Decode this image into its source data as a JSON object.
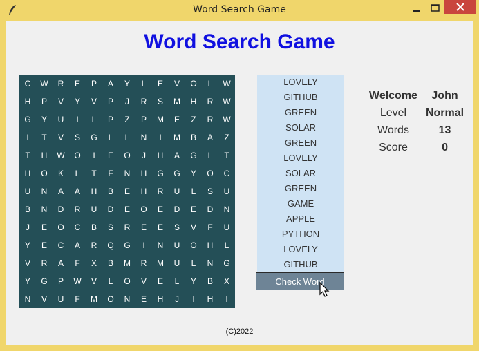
{
  "window": {
    "title": "Word Search Game"
  },
  "heading": "Word Search Game",
  "grid": [
    [
      "C",
      "W",
      "R",
      "E",
      "P",
      "A",
      "Y",
      "L",
      "E",
      "V",
      "O",
      "L",
      "W"
    ],
    [
      "H",
      "P",
      "V",
      "Y",
      "V",
      "P",
      "J",
      "R",
      "S",
      "M",
      "H",
      "R",
      "W"
    ],
    [
      "G",
      "Y",
      "U",
      "I",
      "L",
      "P",
      "Z",
      "P",
      "M",
      "E",
      "Z",
      "R",
      "W"
    ],
    [
      "I",
      "T",
      "V",
      "S",
      "G",
      "L",
      "L",
      "N",
      "I",
      "M",
      "B",
      "A",
      "Z"
    ],
    [
      "T",
      "H",
      "W",
      "O",
      "I",
      "E",
      "O",
      "J",
      "H",
      "A",
      "G",
      "L",
      "T"
    ],
    [
      "H",
      "O",
      "K",
      "L",
      "T",
      "F",
      "N",
      "H",
      "G",
      "G",
      "Y",
      "O",
      "C"
    ],
    [
      "U",
      "N",
      "A",
      "A",
      "H",
      "B",
      "E",
      "H",
      "R",
      "U",
      "L",
      "S",
      "U"
    ],
    [
      "B",
      "N",
      "D",
      "R",
      "U",
      "D",
      "E",
      "O",
      "E",
      "D",
      "E",
      "D",
      "N"
    ],
    [
      "J",
      "E",
      "O",
      "C",
      "B",
      "S",
      "R",
      "E",
      "E",
      "S",
      "V",
      "F",
      "U"
    ],
    [
      "Y",
      "E",
      "C",
      "A",
      "R",
      "Q",
      "G",
      "I",
      "N",
      "U",
      "O",
      "H",
      "L"
    ],
    [
      "V",
      "R",
      "A",
      "F",
      "X",
      "B",
      "M",
      "R",
      "M",
      "U",
      "L",
      "N",
      "G"
    ],
    [
      "Y",
      "G",
      "P",
      "W",
      "V",
      "L",
      "O",
      "V",
      "E",
      "L",
      "Y",
      "B",
      "X"
    ],
    [
      "N",
      "V",
      "U",
      "F",
      "M",
      "O",
      "N",
      "E",
      "H",
      "J",
      "I",
      "H",
      "I"
    ]
  ],
  "words": [
    "LOVELY",
    "GITHUB",
    "GREEN",
    "SOLAR",
    "GREEN",
    "LOVELY",
    "SOLAR",
    "GREEN",
    "GAME",
    "APPLE",
    "PYTHON",
    "LOVELY",
    "GITHUB"
  ],
  "check_button": "Check Word",
  "info": {
    "welcome_label": "Welcome",
    "welcome_value": "John",
    "level_label": "Level",
    "level_value": "Normal",
    "words_label": "Words",
    "words_value": "13",
    "score_label": "Score",
    "score_value": "0"
  },
  "footer": "(C)2022",
  "colors": {
    "titlebar": "#f0d66b",
    "heading": "#1010e0",
    "grid_bg": "#244f57",
    "wordlist_bg": "#cfe3f4",
    "button_bg": "#6e8496",
    "close_button": "#c9453d"
  }
}
